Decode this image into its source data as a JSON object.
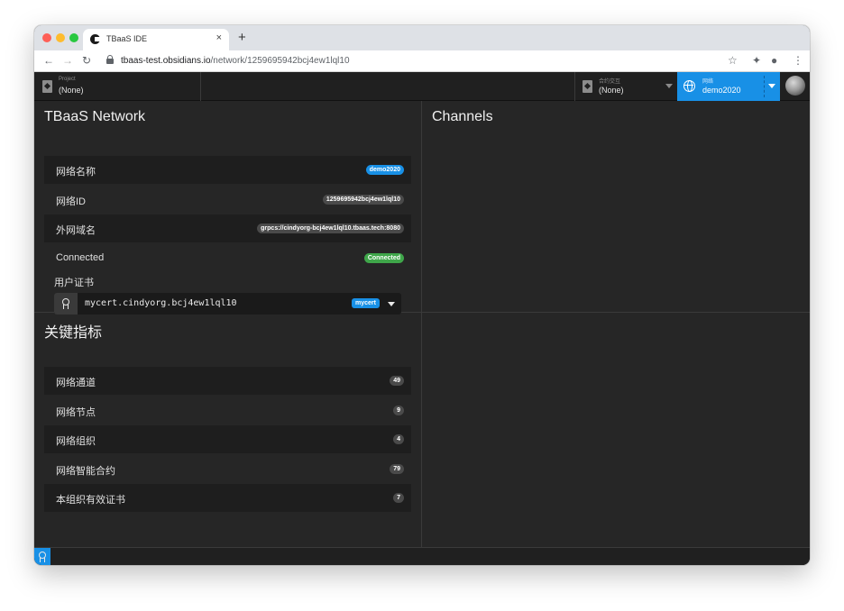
{
  "browser": {
    "tab_title": "TBaaS IDE",
    "tab_close": "×",
    "new_tab": "+",
    "url_host": "tbaas-test.obsidians.io",
    "url_path": "/network/1259695942bcj4ew1lql10",
    "back": "←",
    "forward": "→",
    "reload": "↻",
    "star": "☆",
    "extensions": "✦",
    "account": "●",
    "menu": "⋮"
  },
  "header": {
    "project_label": "Project",
    "project_value": "(None)",
    "contract_label": "合约交互",
    "contract_value": "(None)",
    "network_label": "网络",
    "network_value": "demo2020"
  },
  "network_panel": {
    "title": "TBaaS Network",
    "rows": [
      {
        "label": "网络名称",
        "value": "demo2020"
      },
      {
        "label": "网络ID",
        "value": "1259695942bcj4ew1lql10"
      },
      {
        "label": "外网域名",
        "value": "grpcs://cindyorg-bcj4ew1lql10.tbaas.tech:8080"
      },
      {
        "label": "Connected",
        "value": "Connected"
      }
    ],
    "cert_label": "用户证书",
    "cert_value": "mycert.cindyorg.bcj4ew1lql10",
    "cert_badge": "mycert"
  },
  "channels_panel": {
    "title": "Channels"
  },
  "metrics_panel": {
    "title": "关键指标",
    "rows": [
      {
        "label": "网络通道",
        "value": "49"
      },
      {
        "label": "网络节点",
        "value": "9"
      },
      {
        "label": "网络组织",
        "value": "4"
      },
      {
        "label": "网络智能合约",
        "value": "79"
      },
      {
        "label": "本组织有效证书",
        "value": "7"
      }
    ]
  },
  "colors": {
    "accent": "#1890e6",
    "success": "#3fa64a",
    "background": "#262626"
  }
}
